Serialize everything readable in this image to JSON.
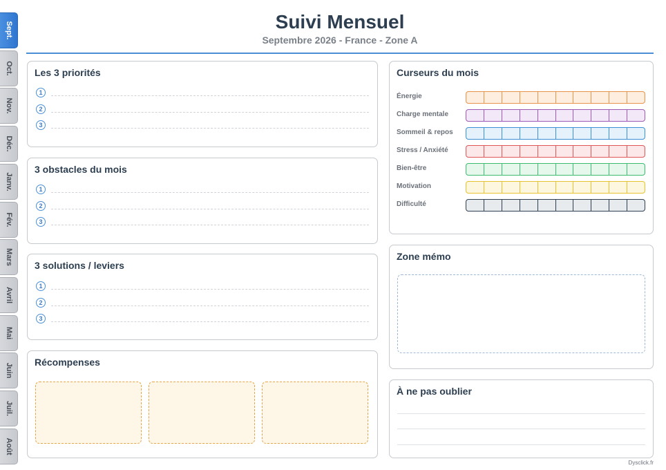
{
  "months": [
    "Sept.",
    "Oct.",
    "Nov.",
    "Déc.",
    "Janv.",
    "Fév.",
    "Mars",
    "Avril",
    "Mai",
    "Juin",
    "Juil.",
    "Août"
  ],
  "active_month_index": 0,
  "header": {
    "title": "Suivi Mensuel",
    "subtitle": "Septembre 2026 - France - Zone A"
  },
  "priorities": {
    "title": "Les 3 priorités",
    "numbers": [
      "1",
      "2",
      "3"
    ]
  },
  "obstacles": {
    "title": "3 obstacles du mois",
    "numbers": [
      "1",
      "2",
      "3"
    ]
  },
  "solutions": {
    "title": "3 solutions / leviers",
    "numbers": [
      "1",
      "2",
      "3"
    ]
  },
  "rewards": {
    "title": "Récompenses",
    "count": 3
  },
  "sliders": {
    "title": "Curseurs du mois",
    "segments": 10,
    "items": [
      {
        "label": "Énergie",
        "color": "#e8924a",
        "fill": "#fdeee0"
      },
      {
        "label": "Charge mentale",
        "color": "#9b59b6",
        "fill": "#f3e8f7"
      },
      {
        "label": "Sommeil & repos",
        "color": "#3a8fd6",
        "fill": "#e6f2fb"
      },
      {
        "label": "Stress / Anxiété",
        "color": "#e05555",
        "fill": "#fce8e8"
      },
      {
        "label": "Bien-être",
        "color": "#3cba6e",
        "fill": "#e6f7ec"
      },
      {
        "label": "Motivation",
        "color": "#e8c22e",
        "fill": "#fdf7df"
      },
      {
        "label": "Difficulté",
        "color": "#2c3e50",
        "fill": "#e8ebee"
      }
    ]
  },
  "memo": {
    "title": "Zone mémo"
  },
  "reminders": {
    "title": "À ne pas oublier"
  },
  "footer": {
    "credit": "Dysclick.fr"
  }
}
